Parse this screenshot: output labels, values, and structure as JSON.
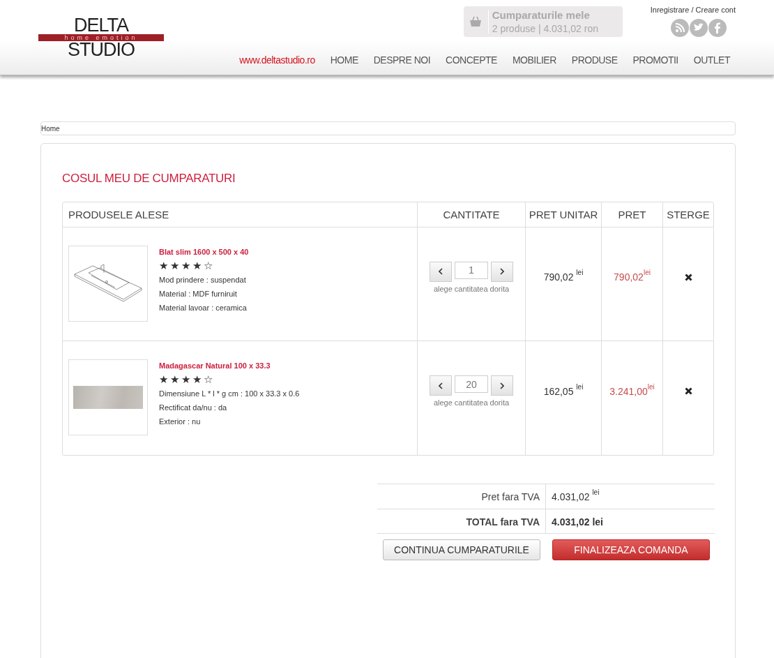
{
  "logo": {
    "top": "DELTA",
    "tagline": "home emotion",
    "bottom": "STUDIO"
  },
  "cart_summary": {
    "title": "Cumparaturile mele",
    "details": "2 produse | 4.031,02 ron"
  },
  "account_link": "Inregistrare / Creare cont",
  "site_link": "www.deltastudio.ro",
  "nav": [
    "HOME",
    "DESPRE NOI",
    "CONCEPTE",
    "MOBILIER",
    "PRODUSE",
    "PROMOTII",
    "OUTLET"
  ],
  "breadcrumb": [
    "Home"
  ],
  "page_title": "COSUL MEU DE CUMPARATURI",
  "table": {
    "columns": [
      "PRODUSELE ALESE",
      "CANTITATE",
      "PRET UNITAR",
      "PRET",
      "STERGE"
    ],
    "rows": [
      {
        "kind": "sink",
        "name": "Blat slim 1600 x 500 x 40",
        "stars": 4,
        "specs": [
          "Mod prindere : suspendat",
          "Material : MDF furniruit",
          "Material lavoar : ceramica"
        ],
        "quantity": "1",
        "quantity_hint": "alege cantitatea dorita",
        "unit_price": "790,02 $^{lei}$",
        "price": "790,02$^{lei}$"
      },
      {
        "kind": "tile",
        "name": "Madagascar Natural 100 x 33.3",
        "stars": 4,
        "specs": [
          "Dimensiune L * l * g cm : 100 x 33.3 x 0.6",
          "Rectificat da/nu : da",
          "Exterior : nu"
        ],
        "quantity": "20",
        "quantity_hint": "alege cantitatea dorita",
        "unit_price": "162,05 $^{lei}$",
        "price": "3.241,00$^{lei}$"
      }
    ]
  },
  "totals": [
    {
      "label": "Pret fara TVA",
      "value": "4.031,02 $^{lei}$",
      "bold": false
    },
    {
      "label": "TOTAL fara TVA",
      "value": "4.031,02 lei",
      "bold": true
    }
  ],
  "buttons": [
    {
      "kind": "secondary",
      "label": "CONTINUA CUMPARATURILE"
    },
    {
      "kind": "primary",
      "label": "FINALIZEAZA COMANDA"
    }
  ]
}
